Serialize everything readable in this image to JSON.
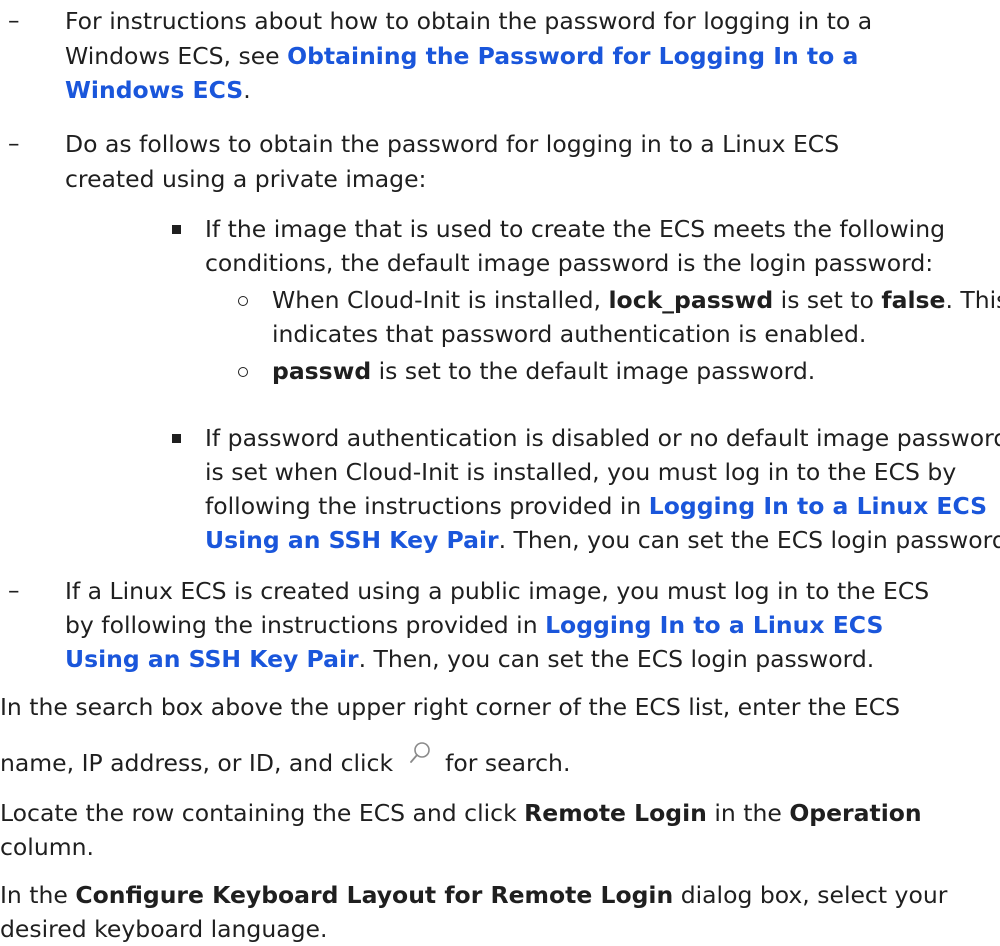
{
  "item1": {
    "marker": "–",
    "line1": "For instructions about how to obtain the password for logging in to a",
    "line2_prefix": "Windows ECS, see ",
    "link_part1": "Obtaining the Password for Logging In to a",
    "link_part2": "Windows ECS",
    "line3_suffix": "."
  },
  "item2": {
    "marker": "–",
    "line1": "Do as follows to obtain the password for logging in to a Linux ECS",
    "line2": "created using a private image:",
    "sub1": {
      "line1": "If the image that is used to create the ECS meets the following",
      "line2": "conditions, the default image password is the login password:",
      "c1_pre": "When Cloud-Init is installed, ",
      "c1_b1": "lock_passwd",
      "c1_mid": " is set to ",
      "c1_b2": "false",
      "c1_post": ". This",
      "c1_line2": "indicates that password authentication is enabled.",
      "c2_b": "passwd",
      "c2_post": " is set to the default image password."
    },
    "sub2": {
      "line1": "If password authentication is disabled or no default image password",
      "line2": "is set when Cloud-Init is installed, you must log in to the ECS by",
      "line3_pre": "following the instructions provided in ",
      "link_a": "Logging In to a Linux ECS",
      "link_b": "Using an SSH Key Pair",
      "line4_post": ". Then, you can set the ECS login password."
    }
  },
  "item3": {
    "marker": "–",
    "line1": "If a Linux ECS is created using a public image, you must log in to the ECS",
    "line2_pre": "by following the instructions provided in ",
    "link_a": "Logging In to a Linux ECS",
    "link_b": "Using an SSH Key Pair",
    "line3_post": ". Then, you can set the ECS login password."
  },
  "step_search": {
    "line1": "In the search box above the upper right corner of the ECS list, enter the ECS",
    "line2_pre": "name, IP address, or ID, and click",
    "icon": "search-icon",
    "line2_post": "for search."
  },
  "step_locate": {
    "pre": "Locate the row containing the ECS and click ",
    "b1": "Remote Login",
    "mid": " in the ",
    "b2": "Operation",
    "line2": "column."
  },
  "step_dialog": {
    "pre": "In the ",
    "b1": "Configure Keyboard Layout for Remote Login",
    "post": " dialog box, select your",
    "line2": "desired keyboard language."
  },
  "colors": {
    "link": "#1a56db",
    "text": "#1f1f1f"
  }
}
